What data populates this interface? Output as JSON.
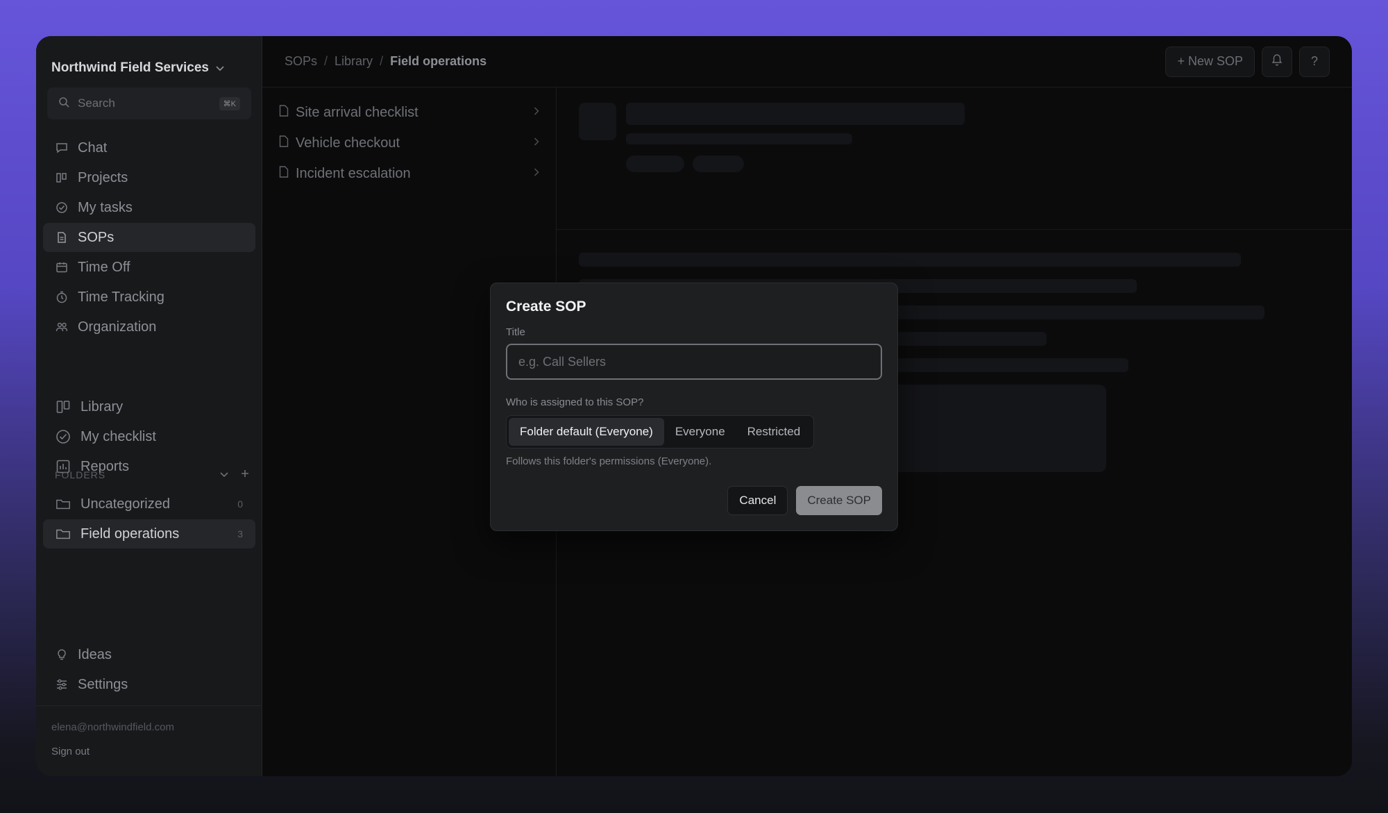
{
  "sidebar": {
    "workspace": "Northwind Field Services",
    "search": {
      "placeholder": "Search",
      "shortcut": "⌘K"
    },
    "main_nav": [
      {
        "label": "Chat",
        "icon": "chat-icon"
      },
      {
        "label": "Projects",
        "icon": "board-icon"
      },
      {
        "label": "My tasks",
        "icon": "check-circle-icon"
      },
      {
        "label": "SOPs",
        "icon": "document-icon",
        "active": true
      },
      {
        "label": "Time Off",
        "icon": "calendar-icon"
      },
      {
        "label": "Time Tracking",
        "icon": "stopwatch-icon"
      },
      {
        "label": "Organization",
        "icon": "people-icon"
      }
    ],
    "sop_nav": [
      {
        "label": "Library",
        "icon": "board-icon"
      },
      {
        "label": "My checklist",
        "icon": "check-circle-icon"
      },
      {
        "label": "Reports",
        "icon": "chart-icon"
      }
    ],
    "folders": {
      "label": "FOLDERS",
      "items": [
        {
          "label": "Uncategorized",
          "count": "0"
        },
        {
          "label": "Field operations",
          "count": "3",
          "active": true
        }
      ]
    },
    "bottom_nav": [
      {
        "label": "Ideas",
        "icon": "lightbulb-icon"
      },
      {
        "label": "Settings",
        "icon": "sliders-icon"
      }
    ],
    "user_email": "elena@northwindfield.com",
    "sign_out": "Sign out"
  },
  "topbar": {
    "breadcrumb": [
      "SOPs",
      "Library",
      "Field operations"
    ],
    "new_sop": "+ New SOP",
    "help": "?"
  },
  "sop_list": [
    "Site arrival checklist",
    "Vehicle checkout",
    "Incident escalation"
  ],
  "modal": {
    "title": "Create SOP",
    "title_label": "Title",
    "title_placeholder": "e.g. Call Sellers",
    "title_value": "",
    "assign_label": "Who is assigned to this SOP?",
    "options": [
      "Folder default (Everyone)",
      "Everyone",
      "Restricted"
    ],
    "selected_option": "Folder default (Everyone)",
    "help_text": "Follows this folder's permissions (Everyone).",
    "cancel": "Cancel",
    "submit": "Create SOP"
  }
}
